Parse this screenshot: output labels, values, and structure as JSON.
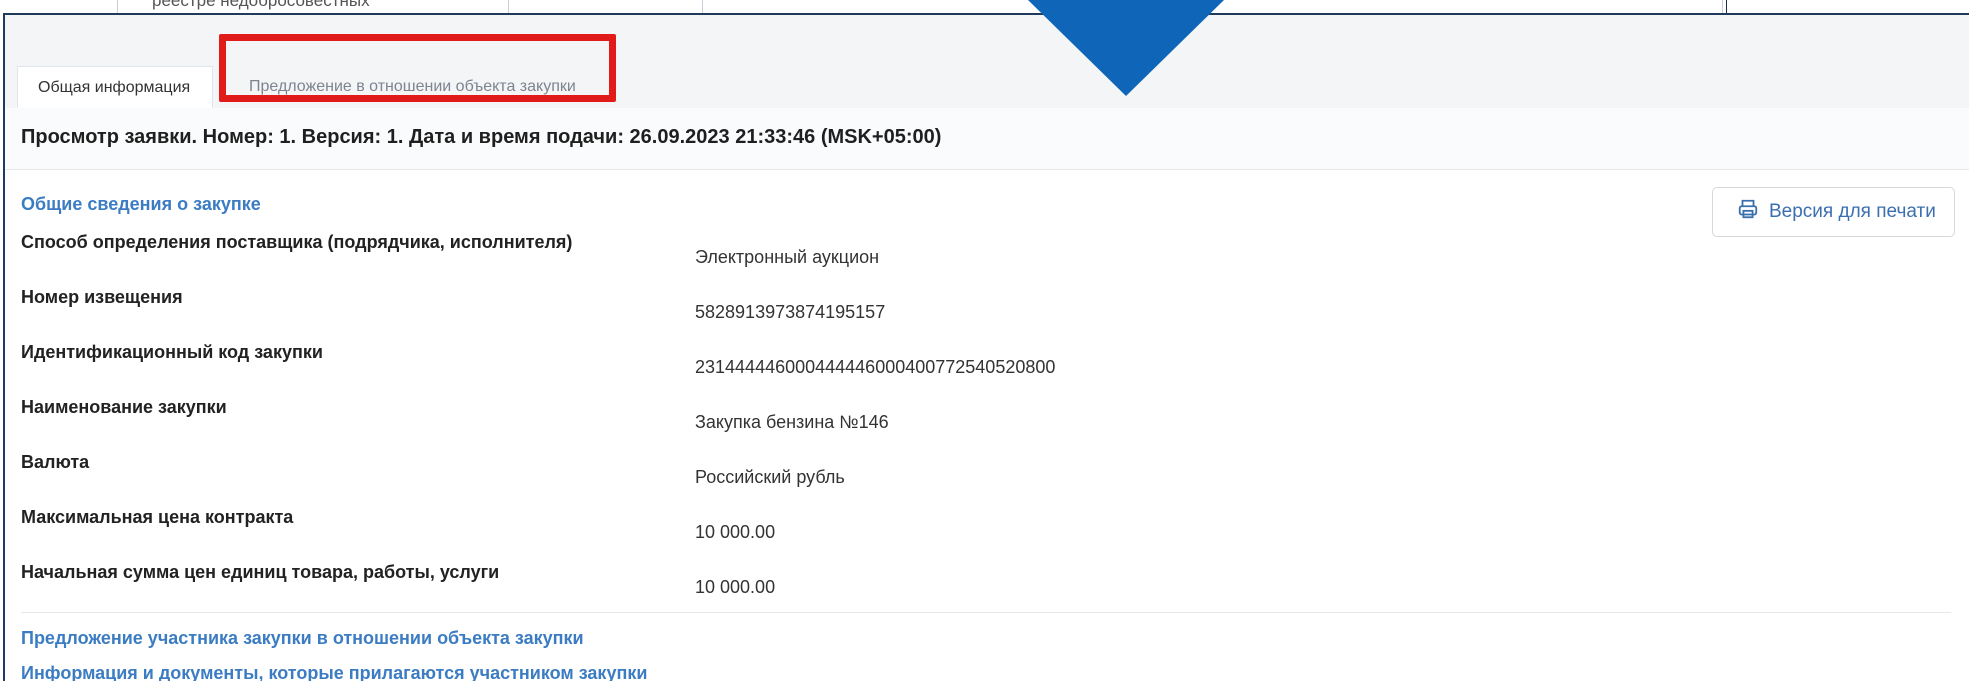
{
  "background": {
    "partial_text": "реестре недобросовестных"
  },
  "tabs": [
    {
      "label": "Общая информация",
      "active": true
    },
    {
      "label": "Предложение в отношении объекта закупки",
      "active": false
    }
  ],
  "page_title": "Просмотр заявки. Номер: 1. Версия: 1. Дата и время подачи: 26.09.2023 21:33:46 (MSK+05:00)",
  "section_general": "Общие сведения о закупке",
  "print_button": {
    "label": "Версия для печати",
    "icon": "printer-icon"
  },
  "rows": [
    {
      "label": "Способ определения поставщика (подрядчика, исполнителя)",
      "value": "Электронный аукцион"
    },
    {
      "label": "Номер извещения",
      "value": "5828913973874195157"
    },
    {
      "label": "Идентификационный код закупки",
      "value": "231444446000444446000400772540520800"
    },
    {
      "label": "Наименование закупки",
      "value": "Закупка бензина №146"
    },
    {
      "label": "Валюта",
      "value": "Российский рубль"
    },
    {
      "label": "Максимальная цена контракта",
      "value": "10 000.00"
    },
    {
      "label": "Начальная сумма цен единиц товара, работы, услуги",
      "value": "10 000.00"
    }
  ],
  "section_offer": "Предложение участника закупки в отношении объекта закупки",
  "section_docs": "Информация и документы, которые прилагаются участником закупки",
  "colors": {
    "highlight": "#e11a1a",
    "arrow": "#0f66b8",
    "link": "#3b7cc2"
  }
}
